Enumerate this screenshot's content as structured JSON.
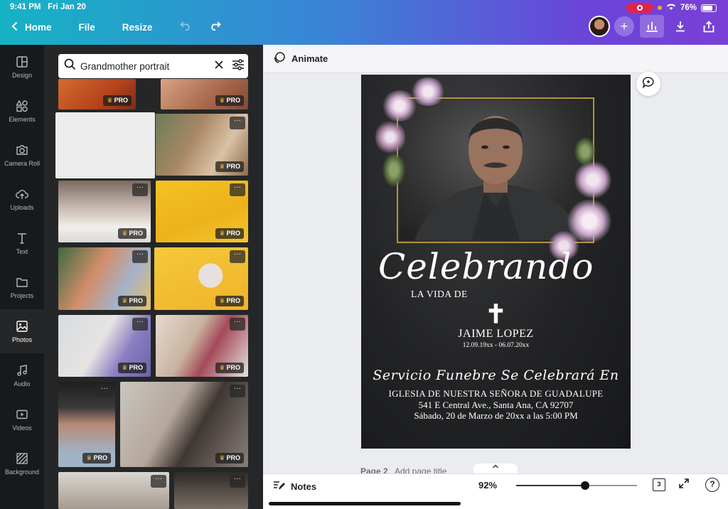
{
  "status": {
    "time": "9:41 PM",
    "date": "Fri Jan 20",
    "battery": "76%"
  },
  "nav": {
    "back_label": "Home",
    "file_label": "File",
    "resize_label": "Resize"
  },
  "rail": [
    {
      "label": "Design",
      "icon": "layout-icon"
    },
    {
      "label": "Elements",
      "icon": "shapes-icon"
    },
    {
      "label": "Camera Roll",
      "icon": "camera-icon"
    },
    {
      "label": "Uploads",
      "icon": "cloud-upload-icon"
    },
    {
      "label": "Text",
      "icon": "text-icon"
    },
    {
      "label": "Projects",
      "icon": "folder-icon"
    },
    {
      "label": "Photos",
      "icon": "image-icon"
    },
    {
      "label": "Audio",
      "icon": "music-icon"
    },
    {
      "label": "Videos",
      "icon": "video-icon"
    },
    {
      "label": "Background",
      "icon": "pattern-icon"
    }
  ],
  "search": {
    "value": "Grandmother portrait"
  },
  "badge": {
    "pro": "PRO",
    "more": "···"
  },
  "subbar": {
    "animate_label": "Animate"
  },
  "design": {
    "title_script": "Celebrando",
    "subtitle": "LA VIDA DE",
    "cross": "✝",
    "name": "JAIME LOPEZ",
    "dates": "12.09.19xx - 06.07.20xx",
    "service_script": "Servicio Funebre Se Celebrará En",
    "place": "IGLESIA DE NUESTRA SEÑORA DE GUADALUPE",
    "address": "541 E Central Ave., Santa Ana, CA 92707",
    "when": "Sábado, 20 de Marzo de 20xx a las 5:00 PM"
  },
  "page_row": {
    "page": "Page 2",
    "add_title": "Add page title"
  },
  "bottom": {
    "notes_label": "Notes",
    "zoom": "92%",
    "zoom_level": 0.57,
    "page_count": "3",
    "help": "?"
  },
  "colors": {
    "gold_frame": "#b8913c",
    "canvas_bg": "#1f2022",
    "accent": "#7a3fd6"
  }
}
